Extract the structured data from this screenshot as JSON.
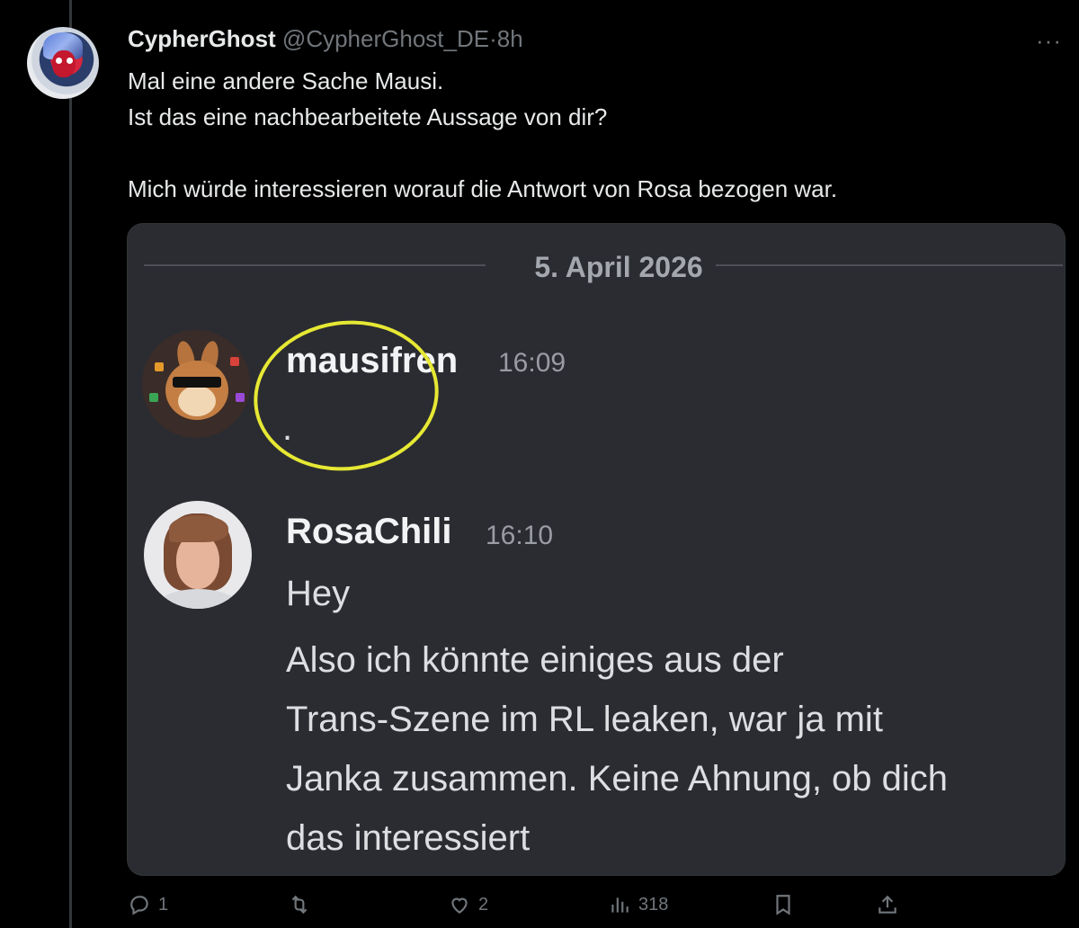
{
  "tweet": {
    "author_name": "CypherGhost",
    "author_handle": "@CypherGhost_DE",
    "separator": "·",
    "time": "8h",
    "more": "···",
    "lines": [
      "Mal eine andere Sache Mausi.",
      "Ist das eine nachbearbeitete Aussage von dir?",
      "Mich würde interessieren worauf die Antwort von Rosa bezogen war."
    ]
  },
  "screenshot": {
    "date": "5. April 2026",
    "messages": [
      {
        "author": "mausifren",
        "time": "16:09",
        "text": "."
      },
      {
        "author": "RosaChili",
        "time": "16:10",
        "text_lines": [
          "Hey",
          "Also ich könnte einiges aus der",
          "Trans-Szene im RL leaken, war ja mit",
          "Janka zusammen. Keine Ahnung, ob dich",
          "das interessiert"
        ]
      }
    ],
    "highlight_color": "#e6e834"
  },
  "actions": {
    "reply_count": "1",
    "retweet_count": "",
    "like_count": "2",
    "views_count": "318",
    "icons": [
      "reply-icon",
      "retweet-icon",
      "like-icon",
      "views-icon",
      "bookmark-icon",
      "share-icon"
    ]
  },
  "colors": {
    "background": "#000000",
    "text": "#e7e9ea",
    "muted": "#71767b",
    "card": "#2b2c31"
  }
}
